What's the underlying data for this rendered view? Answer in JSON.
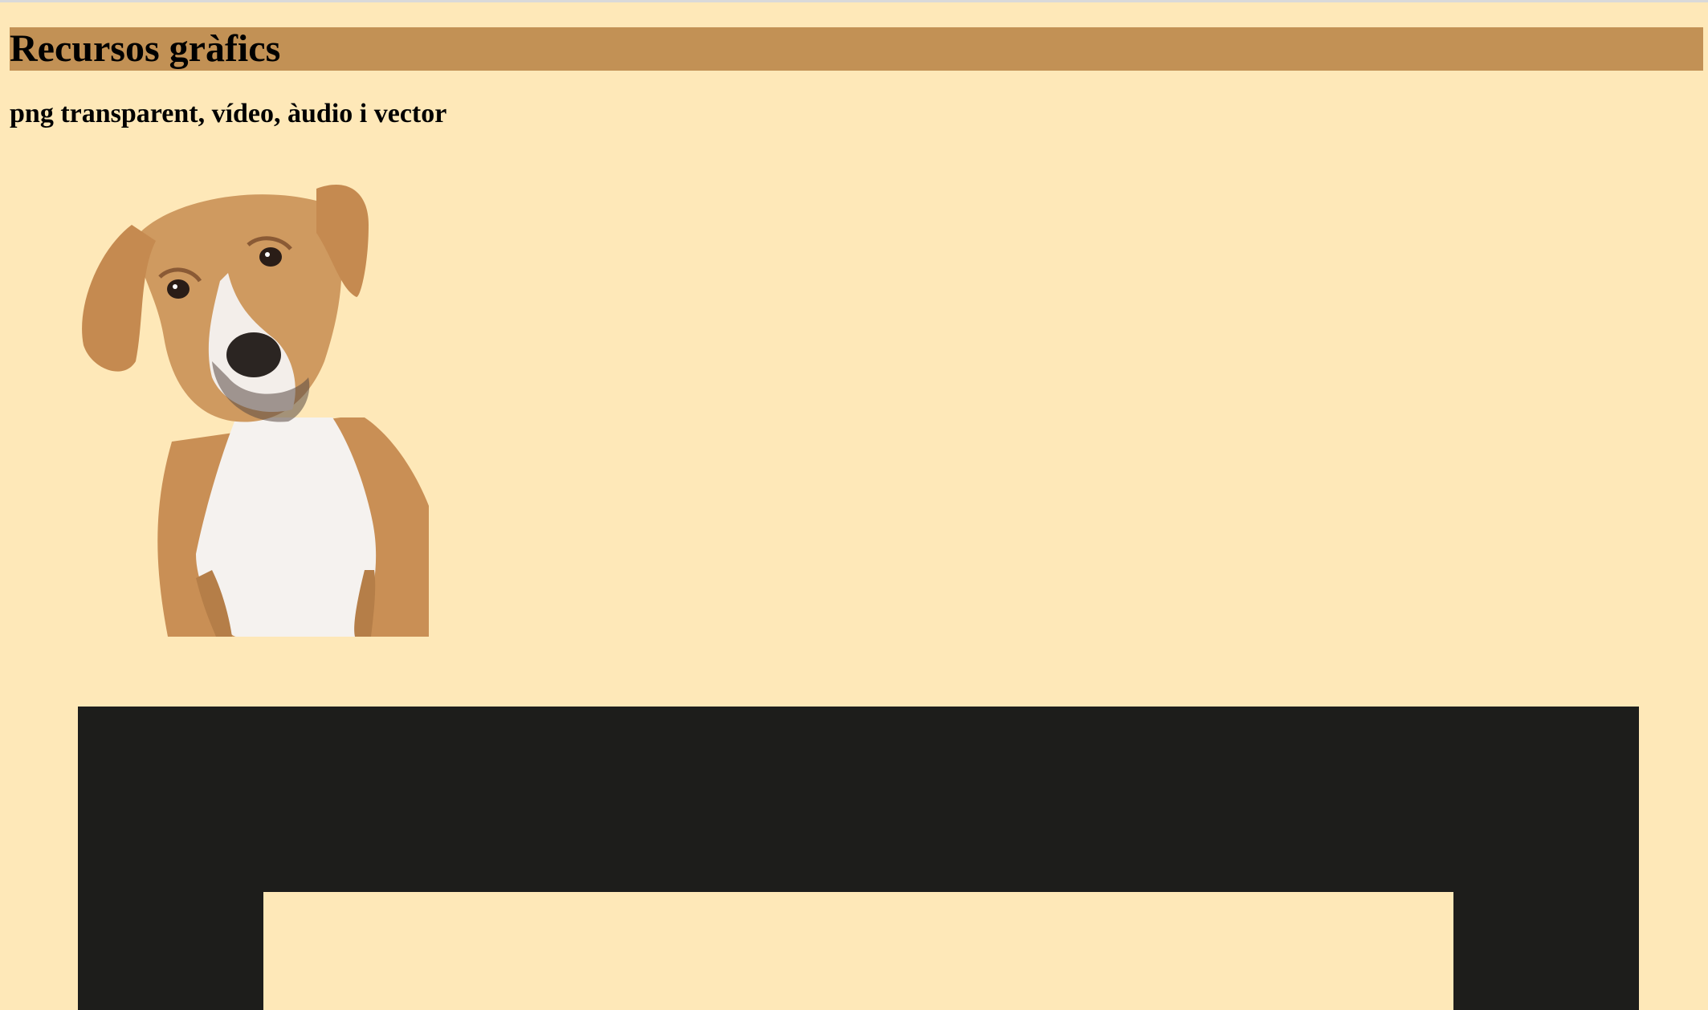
{
  "page": {
    "title": "Recursos gràfics",
    "subtitle": "png transparent, vídeo, àudio i vector"
  },
  "colors": {
    "background": "#fee8b8",
    "title_bar": "#c29155",
    "vector_fill": "#1d1d1b"
  },
  "media": {
    "image_subject": "dog-photo",
    "vector_subject": "black-frame-vector"
  }
}
